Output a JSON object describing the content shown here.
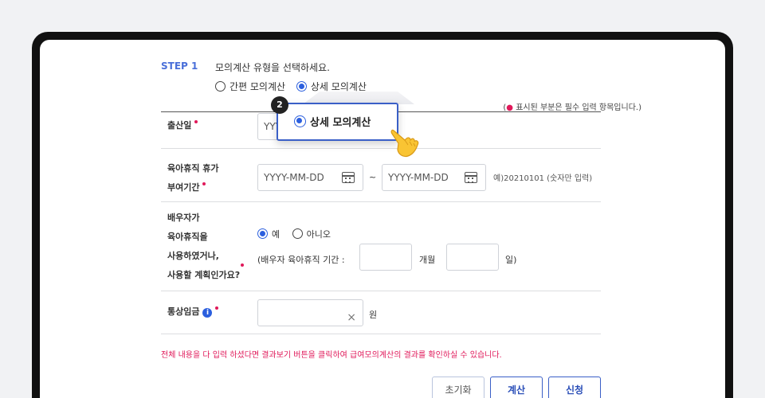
{
  "step": {
    "label": "STEP 1",
    "instruction": "모의계산 유형을 선택하세요.",
    "options": [
      {
        "label": "간편 모의계산",
        "selected": false
      },
      {
        "label": "상세 모의계산",
        "selected": true
      }
    ],
    "required_note_prefix": "(",
    "required_note_dot": "●",
    "required_note": " 표시된 부분은 필수 입력 항목입니다.)"
  },
  "popup": {
    "badge": "2",
    "label": "상세 모의계산"
  },
  "fields": {
    "birth_date": {
      "label": "출산일",
      "placeholder": "YYYY-MM-DD"
    },
    "leave_period": {
      "label_line1": "육아휴직 휴가",
      "label_line2": "부여기간",
      "start_placeholder": "YYYY-MM-DD",
      "end_placeholder": "YYYY-MM-DD",
      "separator": "~",
      "hint": "예)20210101 (숫자만 입력)"
    },
    "spouse_leave": {
      "label_lines": [
        "배우자가",
        "육아휴직을",
        "사용하였거나,",
        "사용할 계획인가요?"
      ],
      "yes": "예",
      "no": "아니오",
      "period_label": "(배우자 육아휴직 기간 :",
      "months_unit": "개월",
      "days_unit": "일)"
    },
    "ordinary_wage": {
      "label": "통상임금",
      "info_glyph": "i",
      "clear_glyph": "×",
      "unit": "원"
    }
  },
  "warning": "전체 내용을 다 입력 하셨다면 결과보기 버튼을 클릭하여 급여모의계산의 결과를 확인하실 수 있습니다.",
  "buttons": {
    "reset": "초기화",
    "calculate": "계산",
    "apply": "신청"
  },
  "colors": {
    "accent": "#2b5fde",
    "required": "#e0195a",
    "step": "#4a6fd9"
  }
}
